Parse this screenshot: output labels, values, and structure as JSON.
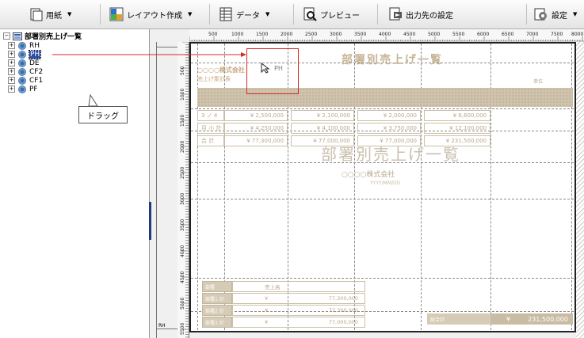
{
  "toolbar": {
    "paper_label": "用紙",
    "layout_label": "レイアウト作成",
    "data_label": "データ",
    "preview_label": "プレビュー",
    "output_label": "出力先の設定",
    "settings_label": "設定"
  },
  "tree": {
    "root": "部署別売上げ一覧",
    "items": [
      {
        "label": "RH"
      },
      {
        "label": "PH"
      },
      {
        "label": "DE"
      },
      {
        "label": "CF2"
      },
      {
        "label": "CF1"
      },
      {
        "label": "PF"
      }
    ],
    "selected": "PH",
    "expander_plus": "+",
    "expander_minus": "−"
  },
  "callout": {
    "label": "ドラッグ"
  },
  "ruler": {
    "h_ticks": [
      "500",
      "1000",
      "1500",
      "2000",
      "2500",
      "3000",
      "3500",
      "4000",
      "4500",
      "5000",
      "5500",
      "6000",
      "6500",
      "7000",
      "7500",
      "8000"
    ],
    "v_ticks": [
      "500",
      "1000",
      "1500",
      "2000",
      "2500",
      "3000",
      "3500",
      "4000",
      "4500",
      "5000",
      "5500"
    ]
  },
  "gutter": {
    "last_label": "RH"
  },
  "report": {
    "title": "部署別売上げ一覧",
    "company": "○○○○株式会社",
    "subtitle": "売上げ集計表",
    "unit": "単位",
    "rows": [
      {
        "label": "3 ノ 4",
        "a": "¥ 2,500,000",
        "b": "¥ 2,100,000",
        "c": "¥ 2,000,000",
        "d": "¥ 6,600,000"
      },
      {
        "label": "月 小 計",
        "a": "¥ 4,250,000",
        "b": "¥ 4,100,000",
        "c": "¥ 3,750,000",
        "d": "¥ 12,100,000"
      },
      {
        "label": "合 計",
        "a": "¥ 77,300,000",
        "b": "¥ 77,000,000",
        "c": "¥ 77,000,000",
        "d": "¥ 231,500,000"
      }
    ],
    "cover_title": "部署別売上げ一覧",
    "cover_company": "○○○○株式会社",
    "cover_date": "YYYY/MM/DD",
    "ghost_label": "PH",
    "footer_header": {
      "dept": "部署",
      "sales": "売上高"
    },
    "footer_rows": [
      {
        "dept": "部署1 計",
        "yen": "¥",
        "amount": "77,300,000"
      },
      {
        "dept": "部署2 計",
        "yen": "¥",
        "amount": "77,300,000"
      },
      {
        "dept": "部署3 計",
        "yen": "¥",
        "amount": "77,000,000"
      }
    ],
    "total_label": "総合計",
    "total_yen": "¥",
    "total_value": "231,500,000"
  },
  "colors": {
    "drag_arrow": "#d42a2a",
    "faded_text": "#b7a88c",
    "band": "#cfc3ad"
  }
}
